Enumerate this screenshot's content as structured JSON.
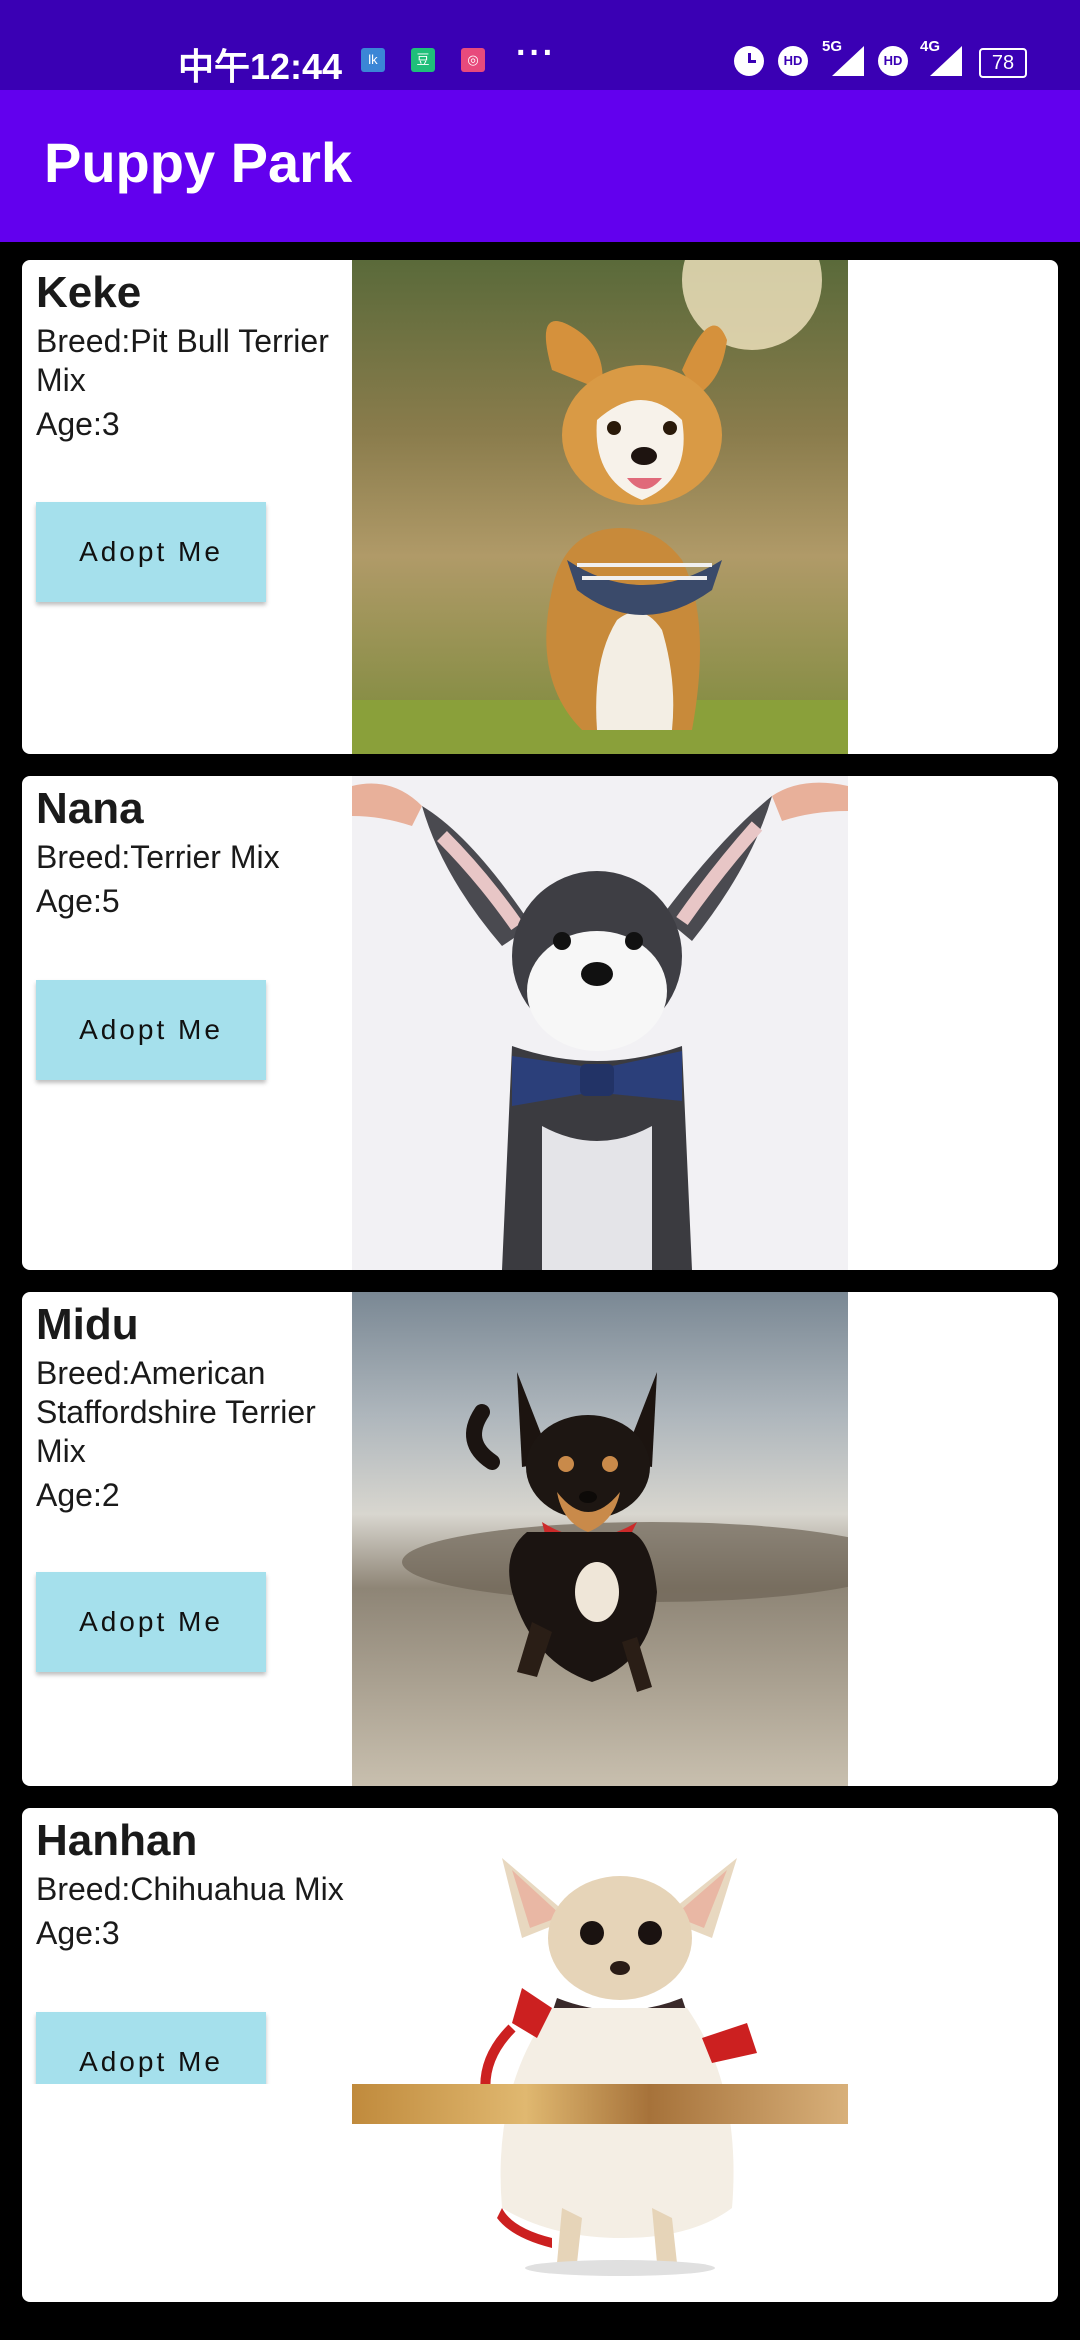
{
  "status_bar": {
    "time": "中午12:44",
    "notifications": [
      "lk",
      "豆",
      "◎"
    ],
    "more": "···",
    "net_5g": "5G",
    "net_4g": "4G",
    "hd_1": "HD",
    "hd_2": "HD",
    "battery": "78"
  },
  "app_bar": {
    "title": "Puppy Park",
    "background": "#6200ee"
  },
  "puppies": [
    {
      "name": "Keke",
      "breed": "Breed:Pit Bull Terrier Mix",
      "age": "Age:3",
      "adopt_label": "Adopt Me"
    },
    {
      "name": "Nana",
      "breed": "Breed:Terrier Mix",
      "age": "Age:5",
      "adopt_label": "Adopt Me"
    },
    {
      "name": "Midu",
      "breed": "Breed:American Staffordshire Terrier Mix",
      "age": "Age:2",
      "adopt_label": "Adopt Me"
    },
    {
      "name": "Hanhan",
      "breed": "Breed:Chihuahua Mix",
      "age": "Age:3",
      "adopt_label": "Adopt Me"
    }
  ],
  "colors": {
    "status_bar": "#3a00b4",
    "adopt_button": "#a5e0ec",
    "card": "#ffffff",
    "list_background": "#000000"
  }
}
